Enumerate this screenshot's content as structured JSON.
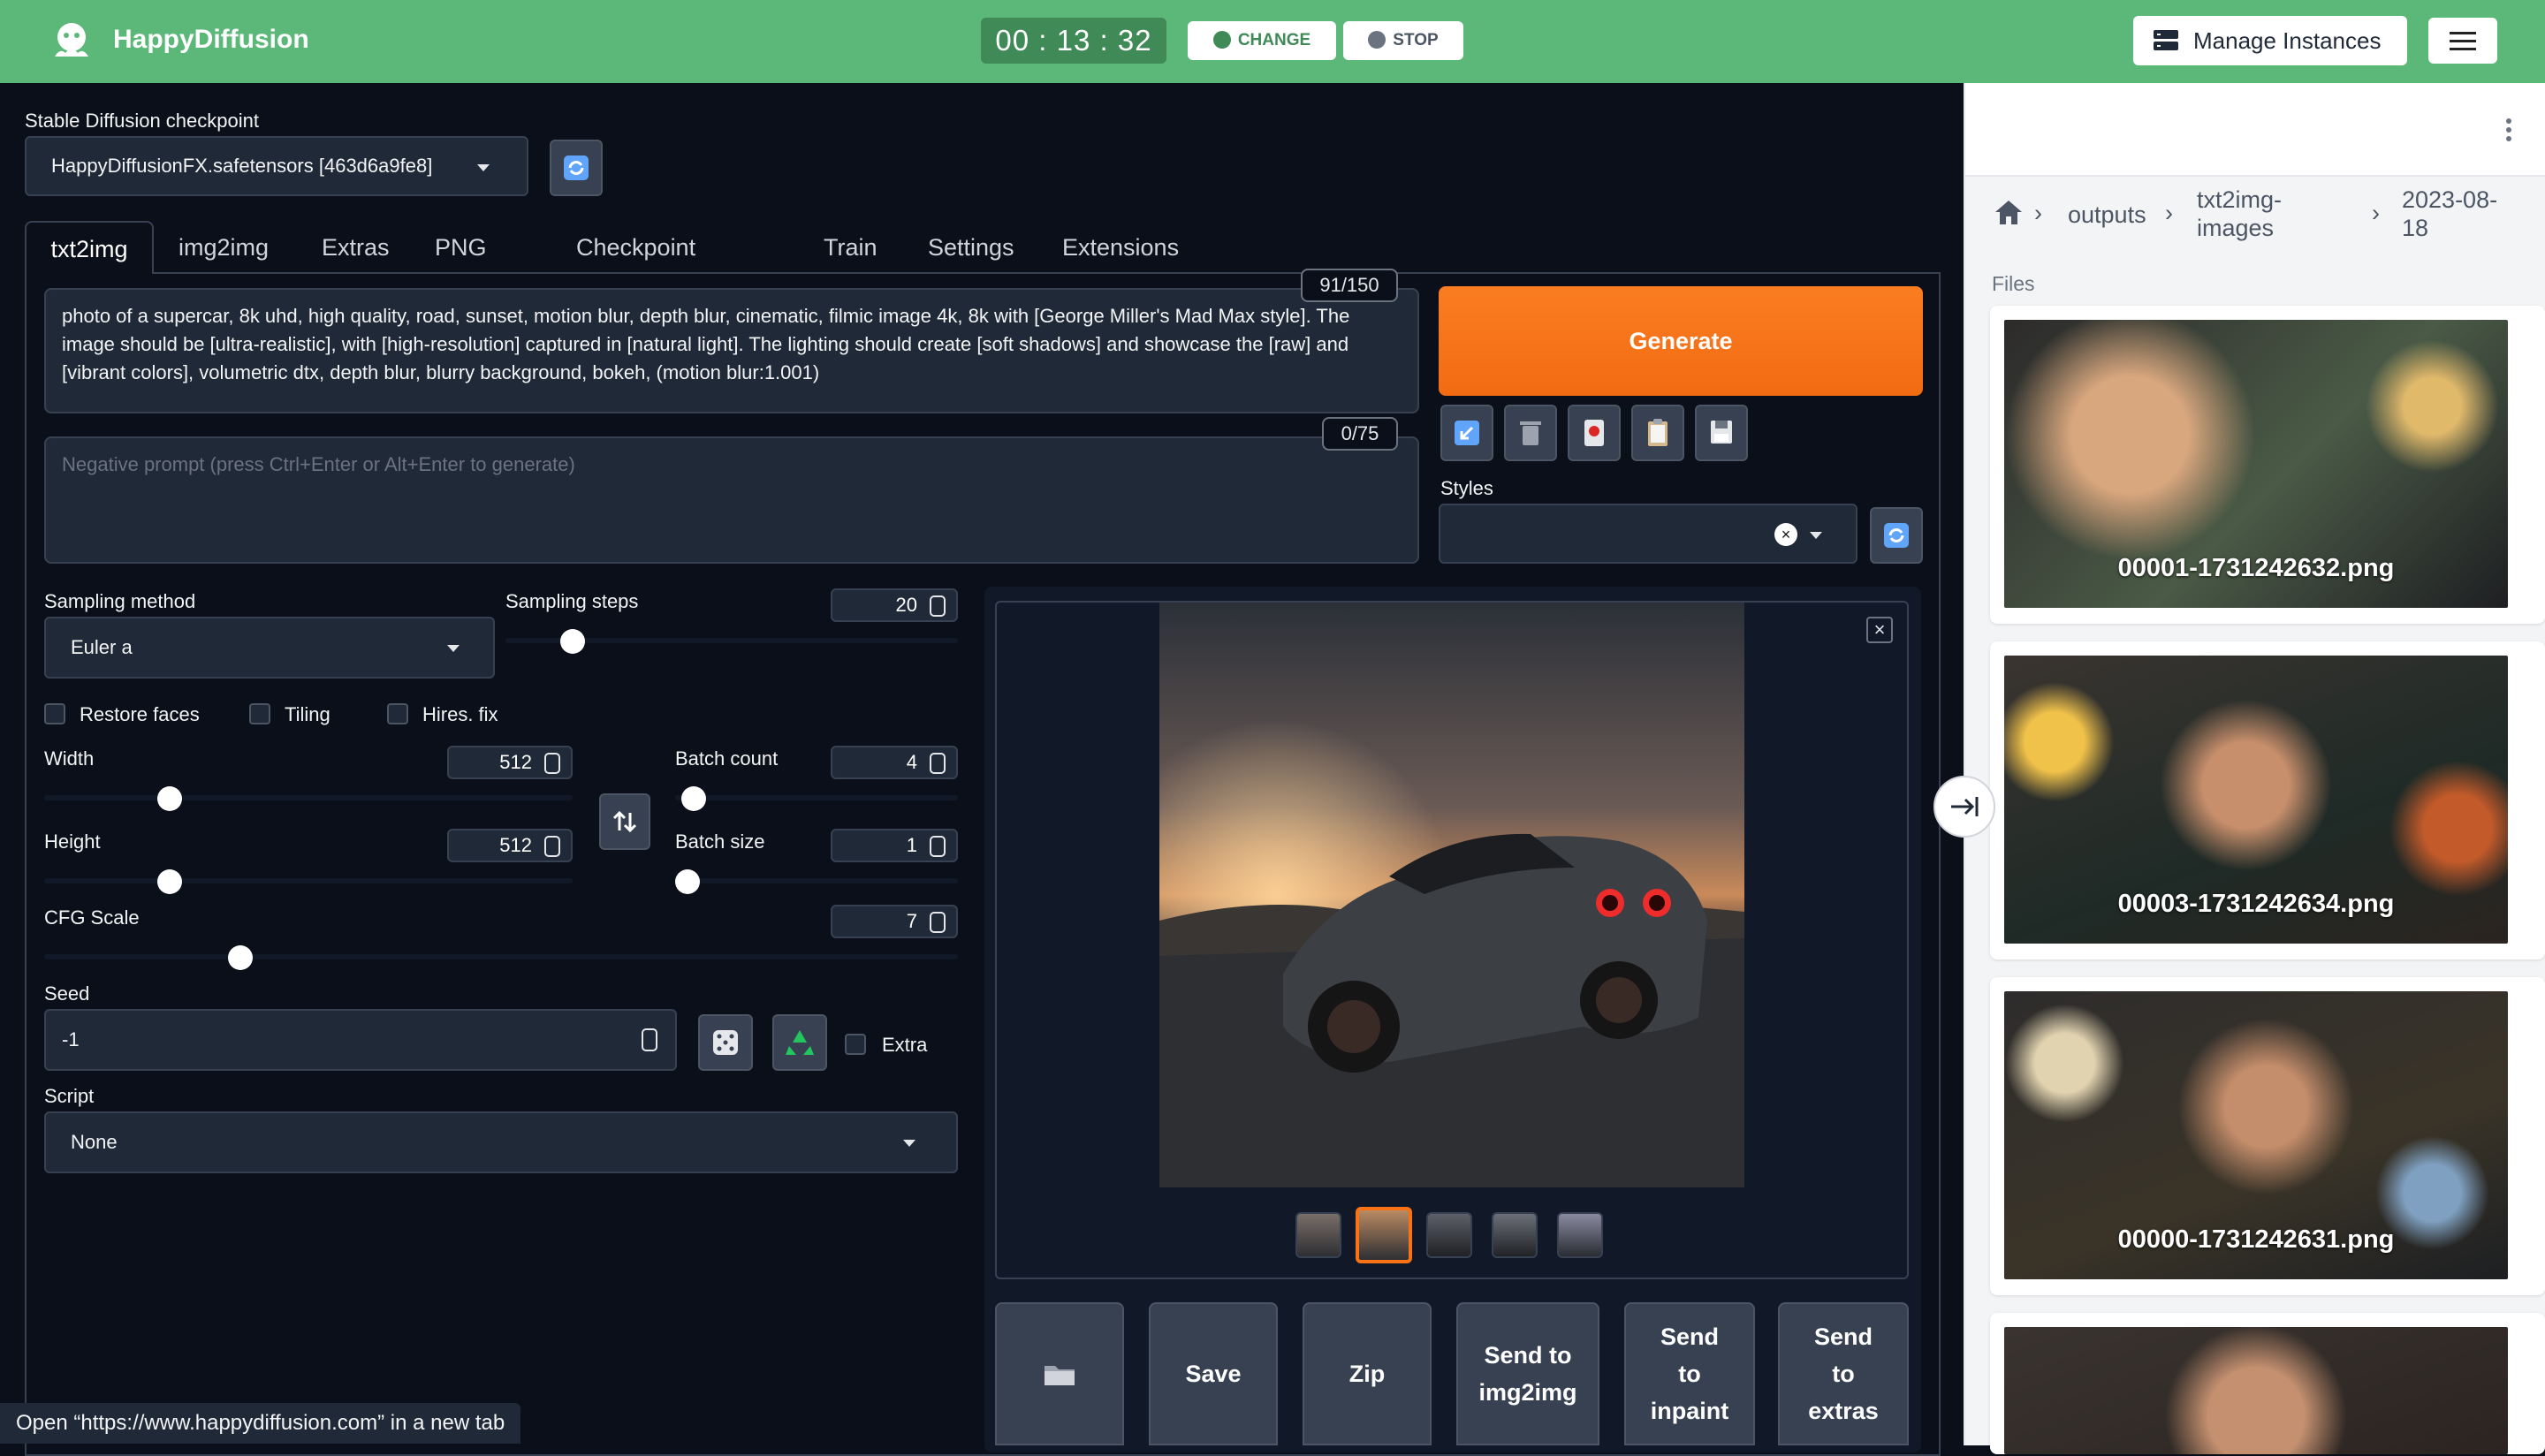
{
  "topbar": {
    "brand": "HappyDiffusion",
    "timer": "00 : 13 : 32",
    "change_label": "CHANGE",
    "stop_label": "STOP",
    "manage_label": "Manage Instances"
  },
  "checkpoint": {
    "label": "Stable Diffusion checkpoint",
    "value": "HappyDiffusionFX.safetensors [463d6a9fe8]"
  },
  "tabs": [
    "txt2img",
    "img2img",
    "Extras",
    "PNG Info",
    "Checkpoint Merger",
    "Train",
    "Settings",
    "Extensions"
  ],
  "prompt": {
    "text": "photo of a supercar, 8k uhd, high quality, road, sunset, motion blur, depth blur, cinematic, filmic image 4k, 8k with [George Miller's Mad Max style]. The image should be [ultra-realistic], with [high-resolution] captured in [natural light]. The lighting should create [soft shadows] and showcase the [raw] and [vibrant colors], volumetric dtx, depth blur, blurry background, bokeh, (motion blur:1.001)",
    "counter": "91/150",
    "negative_placeholder": "Negative prompt (press Ctrl+Enter or Alt+Enter to generate)",
    "negative_counter": "0/75"
  },
  "generate_label": "Generate",
  "styles_label": "Styles",
  "sampling": {
    "method_label": "Sampling method",
    "method_value": "Euler a",
    "steps_label": "Sampling steps",
    "steps_value": "20"
  },
  "checkboxes": {
    "restore_faces": "Restore faces",
    "tiling": "Tiling",
    "hires_fix": "Hires. fix",
    "extra": "Extra"
  },
  "width": {
    "label": "Width",
    "value": "512"
  },
  "height": {
    "label": "Height",
    "value": "512"
  },
  "batch_count": {
    "label": "Batch count",
    "value": "4"
  },
  "batch_size": {
    "label": "Batch size",
    "value": "1"
  },
  "cfg": {
    "label": "CFG Scale",
    "value": "7"
  },
  "seed": {
    "label": "Seed",
    "value": "-1"
  },
  "script": {
    "label": "Script",
    "value": "None"
  },
  "actions": {
    "save": "Save",
    "zip": "Zip",
    "send_img2img": "Send to img2img",
    "send_inpaint": "Send to inpaint",
    "send_extras": "Send to extras"
  },
  "file_browser": {
    "crumbs": [
      "outputs",
      "txt2img-images",
      "2023-08-18"
    ],
    "files_label": "Files",
    "files": [
      "00001-1731242632.png",
      "00003-1731242634.png",
      "00000-1731242631.png"
    ]
  },
  "status_tip": "Open “https://www.happydiffusion.com” in a new tab",
  "colors": {
    "brand_green": "#5cb878",
    "generate_orange": "#f97316",
    "background": "#0b0f19"
  }
}
